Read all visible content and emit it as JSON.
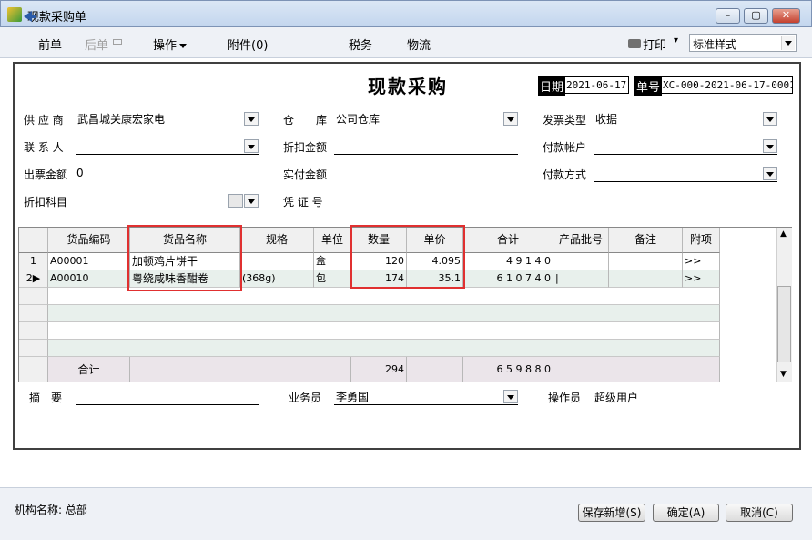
{
  "window": {
    "title": "现款采购单",
    "minimize": "–",
    "maximize": "▢",
    "close": "✕"
  },
  "toolbar": {
    "prev": "前单",
    "next": "后单",
    "operation": "操作",
    "attachment": "附件(0)",
    "tax": "税务",
    "logistics": "物流",
    "print": "打印",
    "print_caret": "▾",
    "style": "标准样式"
  },
  "doc": {
    "title": "现款采购",
    "date_label": "日期",
    "date": "2021-06-17",
    "no_label": "单号",
    "no": "XC-000-2021-06-17-0001"
  },
  "form": {
    "supplier_label": "供 应 商",
    "supplier": "武昌城关康宏家电",
    "warehouse_label": "仓　　库",
    "warehouse": "公司仓库",
    "invoice_type_label": "发票类型",
    "invoice_type": "收据",
    "contact_label": "联 系 人",
    "contact": "",
    "discount_amount_label": "折扣金额",
    "discount_amount": "",
    "pay_account_label": "付款帐户",
    "pay_account": "",
    "invoice_amount_label": "出票金额",
    "invoice_amount": "0",
    "actual_pay_label": "实付金额",
    "actual_pay": "",
    "pay_method_label": "付款方式",
    "pay_method": "",
    "discount_subject_label": "折扣科目",
    "discount_subject": "",
    "voucher_label": "凭 证 号",
    "voucher": ""
  },
  "grid": {
    "headers": [
      "货品编码",
      "货品名称",
      "规格",
      "单位",
      "数量",
      "单价",
      "合计",
      "产品批号",
      "备注",
      "附项"
    ],
    "rows": [
      {
        "idx": "1",
        "code": "A00001",
        "name": "加顿鸡片饼干",
        "spec": "",
        "unit": "盒",
        "qty": "120",
        "price": "4.095",
        "total": "4 9 1 4 0",
        "batch": "",
        "note": "",
        "extra": ">>"
      },
      {
        "idx": "2",
        "code": "A00010",
        "name": "粤绕咸味香酣卷",
        "spec": "(368g)",
        "unit": "包",
        "qty": "174",
        "price": "35.1",
        "total": "6 1 0 7 4 0",
        "batch": "|",
        "note": "",
        "extra": ">>"
      }
    ],
    "total_label": "合计",
    "total_qty": "294",
    "total_amount": "6 5 9 8 8 0"
  },
  "bottom": {
    "summary_label": "摘　要",
    "summary": "",
    "salesman_label": "业务员",
    "salesman": "李勇国",
    "operator_label": "操作员",
    "operator": "超级用户"
  },
  "status": {
    "org": "机构名称: 总部"
  },
  "buttons": {
    "save_new": "保存新增(S)",
    "ok": "确定(A)",
    "cancel": "取消(C)"
  },
  "colors": {
    "highlight": "#e03030",
    "alt_row": "#e8f0ec",
    "total_row": "#ebe5ea"
  }
}
